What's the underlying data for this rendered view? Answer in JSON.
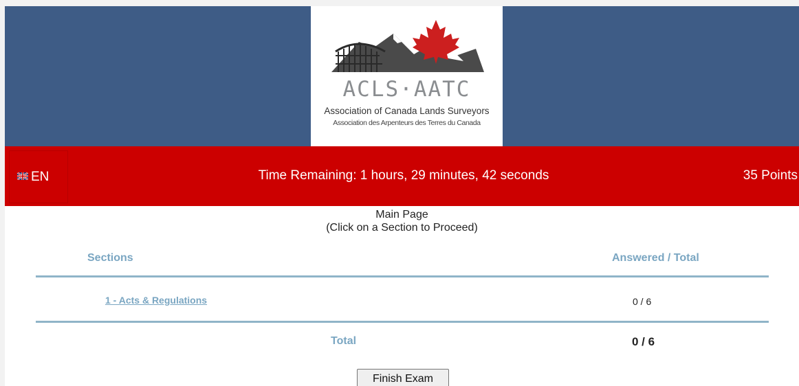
{
  "header": {
    "logo": {
      "acronym": "ACLS·AATC",
      "name_en": "Association of Canada Lands Surveyors",
      "name_fr": "Association des Arpenteurs des Terres du Canada"
    },
    "colors": {
      "band": "#3e5c86",
      "bar": "#cc0000",
      "accent": "#7aa6c2"
    }
  },
  "status_bar": {
    "language": "EN",
    "time_remaining": "Time Remaining: 1 hours, 29 minutes, 42 seconds",
    "points": "35 Points"
  },
  "main": {
    "title": "Main Page",
    "subtitle": "(Click on a Section to Proceed)",
    "columns": {
      "sections": "Sections",
      "answered": "Answered / Total"
    },
    "rows": [
      {
        "section": "1 - Acts & Regulations",
        "answered": "0 / 6"
      }
    ],
    "total": {
      "label": "Total",
      "value": "0 / 6"
    },
    "finish_label": "Finish Exam"
  }
}
